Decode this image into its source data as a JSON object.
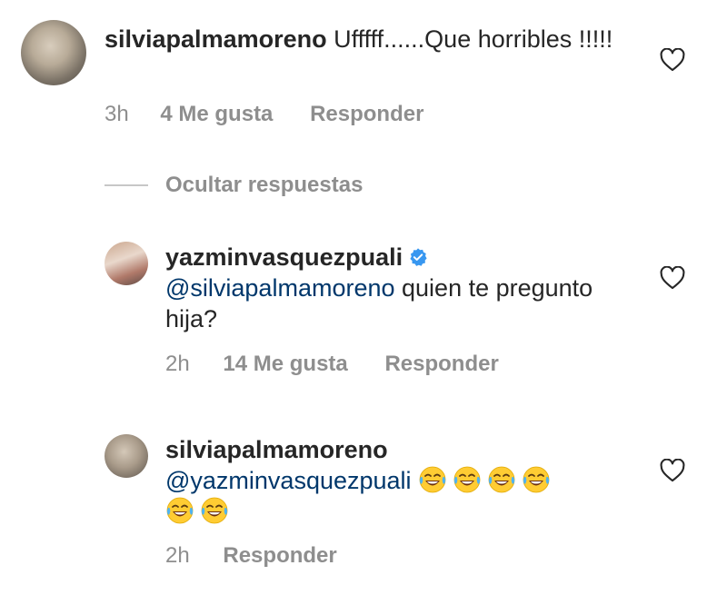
{
  "comments": [
    {
      "username": "silviapalmamoreno",
      "text": " Ufffff......Que horribles !!!!!",
      "time": "3h",
      "likes": "4 Me gusta",
      "reply_label": "Responder"
    },
    {
      "username": "yazminvasquezpuali",
      "verified": true,
      "mention": "@silviapalmamoreno",
      "text": " quien te pregunto hija?",
      "time": "2h",
      "likes": "14 Me gusta",
      "reply_label": "Responder"
    },
    {
      "username": "silviapalmamoreno",
      "mention": "@yazminvasquezpuali",
      "emoji": "face-with-tears-of-joy",
      "emoji_count": 6,
      "time": "2h",
      "reply_label": "Responder"
    }
  ],
  "hide_replies_label": "Ocultar respuestas",
  "colors": {
    "text": "#262626",
    "meta": "#8e8e8e",
    "mention": "#00376b",
    "verified": "#3897f0"
  },
  "icons": {
    "like": "heart-outline-icon",
    "verified": "verified-badge-icon"
  }
}
